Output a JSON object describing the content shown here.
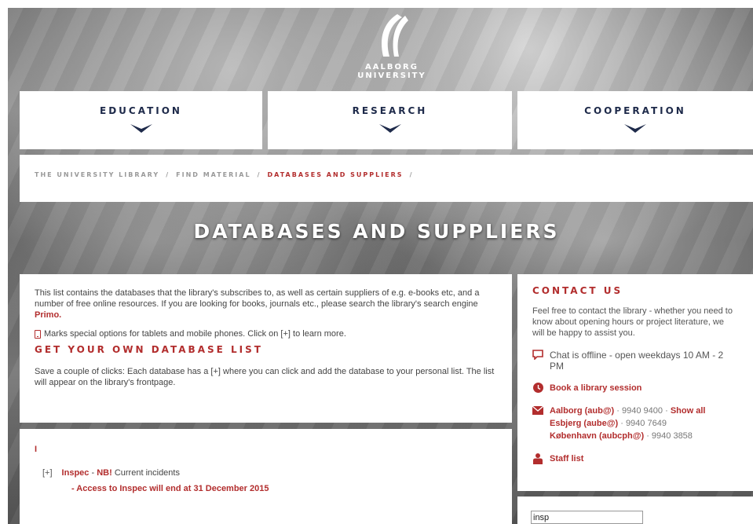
{
  "header": {
    "logo_text": "AALBORG UNIVERSITY"
  },
  "nav": [
    {
      "label": "EDUCATION"
    },
    {
      "label": "RESEARCH"
    },
    {
      "label": "COOPERATION"
    }
  ],
  "breadcrumb": [
    {
      "label": "THE UNIVERSITY LIBRARY"
    },
    {
      "label": "FIND MATERIAL"
    },
    {
      "label": "DATABASES AND SUPPLIERS"
    }
  ],
  "breadcrumb_sep": "/",
  "page_title": "DATABASES AND SUPPLIERS",
  "intro": {
    "text": "This list contains the databases that the library's subscribes to, as well as certain suppliers of e.g. e-books etc, and a number of free online resources. If you are looking for books, journals etc., please search the library's search engine",
    "primo_link": "Primo.",
    "tablet_note": "Marks special options for tablets and mobile phones. Click on [+] to learn more.",
    "heading": "GET YOUR OWN DATABASE LIST",
    "list_text": "Save a couple of clicks: Each database has a [+] where you can click and add the database to your personal list. The list will appear on the library's frontpage."
  },
  "results": {
    "letter": "I",
    "plus": "[+]",
    "db_name": "Inspec",
    "dash": "-",
    "nb": "NB!",
    "incidents": "Current incidents",
    "access_note": "- Access to Inspec will end at 31 December 2015"
  },
  "contact": {
    "heading": "CONTACT US",
    "text": "Feel free to contact the library - whether you need to know about opening hours or project literature, we will be happy to assist you.",
    "chat": "Chat is offline - open weekdays 10 AM - 2 PM",
    "book_session": "Book a library session",
    "locations": [
      {
        "name": "Aalborg (aub@)",
        "phone": "9940 9400"
      },
      {
        "name": "Esbjerg (aube@)",
        "phone": "9940 7649"
      },
      {
        "name": "København (aubcph@)",
        "phone": "9940 3858"
      }
    ],
    "separator": "·",
    "show_all": "Show all",
    "staff_list": "Staff list"
  },
  "search": {
    "value": "insp"
  },
  "colors": {
    "accent": "#b22d2d",
    "navy": "#1e2a4a"
  }
}
